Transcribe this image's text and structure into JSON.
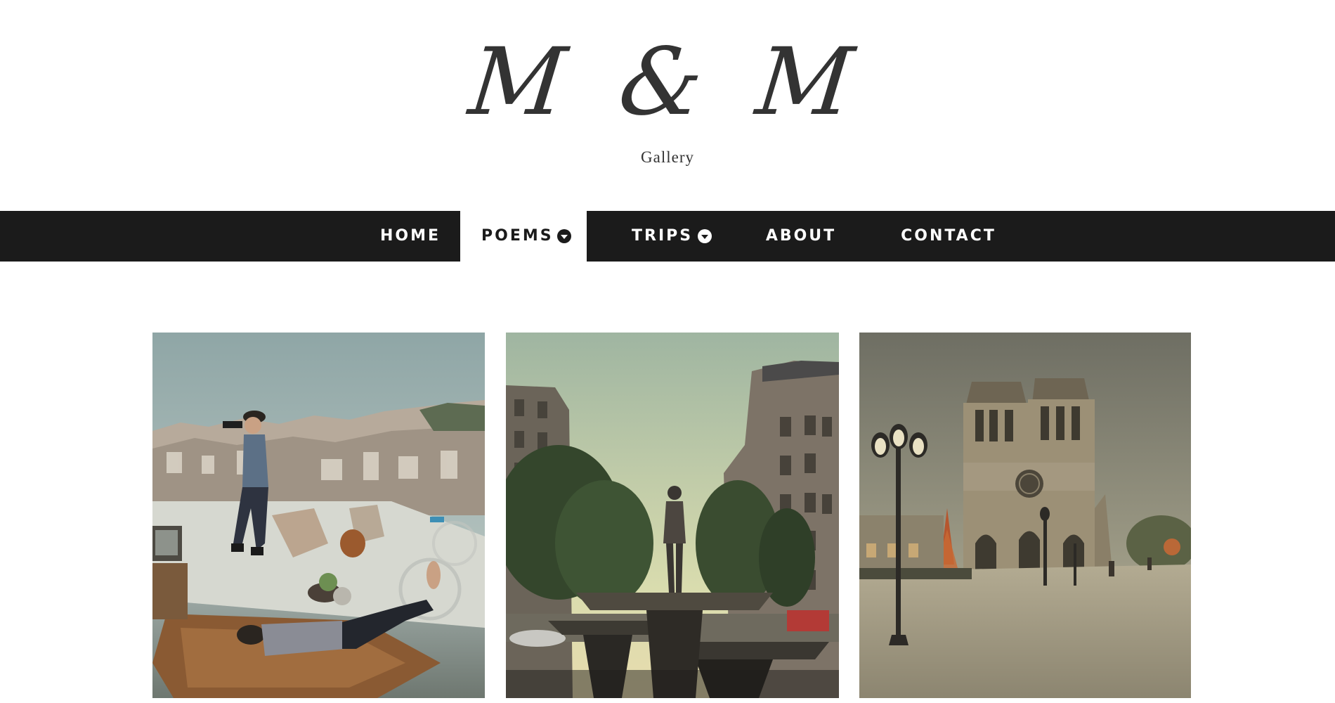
{
  "site": {
    "logo_text": "M & M",
    "tagline": "Gallery"
  },
  "nav": {
    "items": [
      {
        "label": "HOME",
        "has_dropdown": false,
        "active": false
      },
      {
        "label": "POEMS",
        "has_dropdown": true,
        "active": true
      },
      {
        "label": "TRIPS",
        "has_dropdown": true,
        "active": false
      },
      {
        "label": "ABOUT",
        "has_dropdown": false,
        "active": false
      },
      {
        "label": "CONTACT",
        "has_dropdown": false,
        "active": false
      }
    ],
    "dropdown_icon": "chevron-down-circle-icon"
  },
  "gallery": {
    "photos": [
      {
        "subject": "rooftop-photographer-paris-photo"
      },
      {
        "subject": "fountain-statue-paris-street-photo"
      },
      {
        "subject": "notre-dame-cathedral-photo"
      }
    ]
  },
  "colors": {
    "navbar_bg": "#1b1b1b",
    "nav_text": "#ffffff",
    "active_bg": "#ffffff",
    "logo": "#333333"
  }
}
